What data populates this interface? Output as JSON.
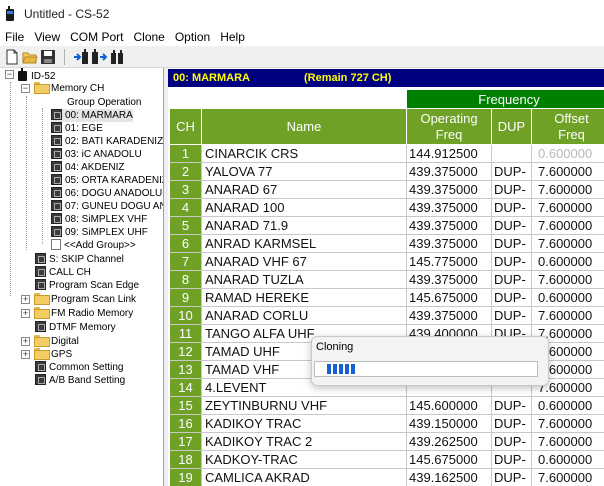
{
  "window": {
    "title": "Untitled - CS-52"
  },
  "menu": [
    "File",
    "View",
    "COM Port",
    "Clone",
    "Option",
    "Help"
  ],
  "toolbar": {
    "buttons": [
      "new-icon",
      "open-icon",
      "save-icon",
      "read-from-radio-icon",
      "write-to-radio-icon",
      "radio-info-icon"
    ]
  },
  "tree": {
    "root": "ID-52",
    "memory_ch": "Memory CH",
    "group_operation": "Group Operation",
    "groups": [
      "00: MARMARA",
      "01: EGE",
      "02: BATI KARADENIZ",
      "03: iC ANADOLU",
      "04: AKDENIZ",
      "05: ORTA KARADENIZ",
      "06: DOGU ANADOLU",
      "07: GUNEU DOGU ANA",
      "08: SiMPLEX VHF",
      "09: SiMPLEX UHF"
    ],
    "add_group": "<<Add Group>>",
    "others": [
      "S: SKIP Channel",
      "CALL CH",
      "Program Scan Edge",
      "Program Scan Link",
      "FM Radio Memory",
      "DTMF Memory",
      "Digital",
      "GPS",
      "Common Setting",
      "A/B Band Setting"
    ]
  },
  "group_header": {
    "name": "00: MARMARA",
    "remain": "(Remain  727 CH)"
  },
  "table": {
    "group_header": "Frequency",
    "columns": {
      "ch": "CH",
      "name": "Name",
      "operating_freq": "Operating\nFreq",
      "dup": "DUP",
      "offset_freq": "Offset\nFreq"
    },
    "rows": [
      {
        "ch": "1",
        "name": "CINARCIK CRS",
        "freq": "144.912500",
        "dup": "",
        "offset": "0.600000"
      },
      {
        "ch": "2",
        "name": "YALOVA 77",
        "freq": "439.375000",
        "dup": "DUP-",
        "offset": "7.600000"
      },
      {
        "ch": "3",
        "name": "ANARAD 67",
        "freq": "439.375000",
        "dup": "DUP-",
        "offset": "7.600000"
      },
      {
        "ch": "4",
        "name": "ANARAD 100",
        "freq": "439.375000",
        "dup": "DUP-",
        "offset": "7.600000"
      },
      {
        "ch": "5",
        "name": "ANARAD 71.9",
        "freq": "439.375000",
        "dup": "DUP-",
        "offset": "7.600000"
      },
      {
        "ch": "6",
        "name": "ANRAD KARMSEL",
        "freq": "439.375000",
        "dup": "DUP-",
        "offset": "7.600000"
      },
      {
        "ch": "7",
        "name": "ANARAD VHF 67",
        "freq": "145.775000",
        "dup": "DUP-",
        "offset": "0.600000"
      },
      {
        "ch": "8",
        "name": "ANARAD TUZLA",
        "freq": "439.375000",
        "dup": "DUP-",
        "offset": "7.600000"
      },
      {
        "ch": "9",
        "name": "RAMAD HEREKE",
        "freq": "145.675000",
        "dup": "DUP-",
        "offset": "0.600000"
      },
      {
        "ch": "10",
        "name": "ANARAD CORLU",
        "freq": "439.375000",
        "dup": "DUP-",
        "offset": "7.600000"
      },
      {
        "ch": "11",
        "name": "TANGO ALFA UHF",
        "freq": "439.400000",
        "dup": "DUP-",
        "offset": "7.600000"
      },
      {
        "ch": "12",
        "name": "TAMAD UHF",
        "freq": "",
        "dup": "",
        "offset": "7.600000"
      },
      {
        "ch": "13",
        "name": "TAMAD VHF",
        "freq": "",
        "dup": "",
        "offset": "0.600000"
      },
      {
        "ch": "14",
        "name": "4.LEVENT",
        "freq": "",
        "dup": "",
        "offset": "7.600000"
      },
      {
        "ch": "15",
        "name": "ZEYTINBURNU VHF",
        "freq": "145.600000",
        "dup": "DUP-",
        "offset": "0.600000"
      },
      {
        "ch": "16",
        "name": "KADIKOY TRAC",
        "freq": "439.150000",
        "dup": "DUP-",
        "offset": "7.600000"
      },
      {
        "ch": "17",
        "name": "KADIKOY TRAC 2",
        "freq": "439.262500",
        "dup": "DUP-",
        "offset": "7.600000"
      },
      {
        "ch": "18",
        "name": "KADKOY-TRAC",
        "freq": "145.675000",
        "dup": "DUP-",
        "offset": "0.600000"
      },
      {
        "ch": "19",
        "name": "CAMLICA AKRAD",
        "freq": "439.162500",
        "dup": "DUP-",
        "offset": "7.600000"
      }
    ]
  },
  "dialog": {
    "title": "Cloning",
    "progress": 0.14
  },
  "colors": {
    "green": "#6fa127",
    "frequency_header": "#008000",
    "navy": "#000080",
    "header_text": "#ffff00",
    "progress": "#1560d4"
  }
}
